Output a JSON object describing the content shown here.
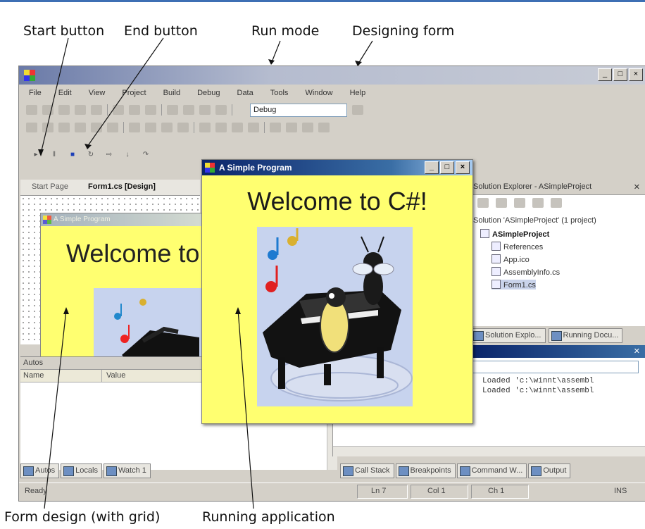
{
  "callouts": {
    "start_button": "Start button",
    "end_button": "End button",
    "run_mode": "Run mode",
    "designing_form": "Designing form",
    "form_design": "Form design (with grid)",
    "running_app": "Running application"
  },
  "ide": {
    "menu": [
      "File",
      "Edit",
      "View",
      "Project",
      "Build",
      "Debug",
      "Data",
      "Tools",
      "Window",
      "Help"
    ],
    "config": "Debug",
    "doc_tabs": [
      "Start Page",
      "Form1.cs [Design]"
    ],
    "designer_form_title": "A Simple Program",
    "designer_welcome": "Welcome to C#!",
    "solution_explorer": {
      "title": "Solution Explorer - ASimpleProject",
      "items": [
        "Solution 'ASimpleProject' (1 project)",
        "ASimpleProject",
        "References",
        "App.ico",
        "AssemblyInfo.cs",
        "Form1.cs"
      ],
      "tabs": [
        "Solution Explo...",
        "Running Docu..."
      ]
    },
    "autos": {
      "title": "Autos",
      "col_name": "Name",
      "col_value": "Value"
    },
    "output_lines": [
      "Loaded 'c:\\winnt\\assembl",
      "Loaded 'c:\\winnt\\assembl"
    ],
    "bottom_left_tabs": [
      "Autos",
      "Locals",
      "Watch 1"
    ],
    "bottom_right_tabs": [
      "Call Stack",
      "Breakpoints",
      "Command W...",
      "Output"
    ],
    "status": {
      "ready": "Ready",
      "ln": "Ln 7",
      "col": "Col 1",
      "ch": "Ch 1",
      "ins": "INS"
    }
  },
  "running": {
    "title": "A Simple Program",
    "welcome": "Welcome to C#!"
  },
  "colors": {
    "form_bg": "#ffff70",
    "title_active": "#0a246a",
    "frame": "#d4d0c8"
  }
}
